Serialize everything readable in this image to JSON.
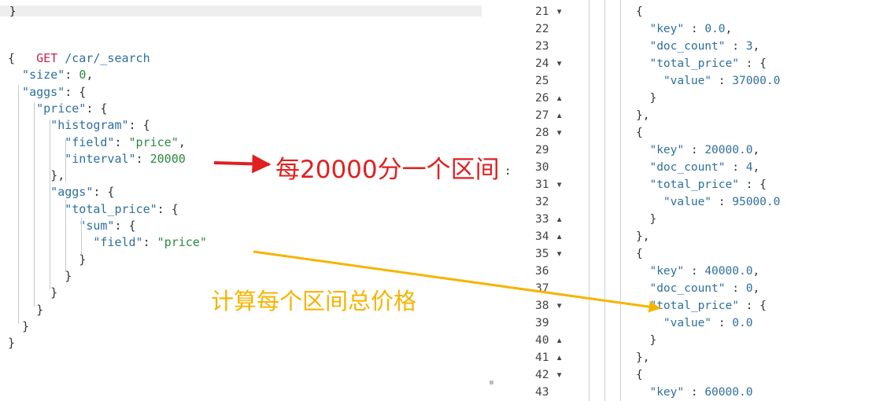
{
  "left": {
    "top_fragment": "}",
    "request_line": {
      "method": "GET",
      "path": "/car/_search"
    },
    "lines": [
      [
        "p",
        "{"
      ],
      [
        "k",
        "  \"size\"",
        "p",
        ": ",
        "n",
        "0",
        "p",
        ","
      ],
      [
        "k",
        "  \"aggs\"",
        "p",
        ": {"
      ],
      [
        "k",
        "    \"price\"",
        "p",
        ": {"
      ],
      [
        "k",
        "      \"histogram\"",
        "p",
        ": {"
      ],
      [
        "k",
        "        \"field\"",
        "p",
        ": ",
        "s",
        "\"price\"",
        "p",
        ","
      ],
      [
        "k",
        "        \"interval\"",
        "p",
        ": ",
        "n",
        "20000"
      ],
      [
        "p",
        "      },"
      ],
      [
        "k",
        "      \"aggs\"",
        "p",
        ": {"
      ],
      [
        "k",
        "        \"total_price\"",
        "p",
        ": {"
      ],
      [
        "k",
        "          \"sum\"",
        "p",
        ": {"
      ],
      [
        "k",
        "            \"field\"",
        "p",
        ": ",
        "s",
        "\"price\""
      ],
      [
        "p",
        "          }"
      ],
      [
        "p",
        "        }"
      ],
      [
        "p",
        "      }"
      ],
      [
        "p",
        "    }"
      ],
      [
        "p",
        "  }"
      ],
      [
        "p",
        "}"
      ]
    ]
  },
  "right": {
    "rows": [
      {
        "num": "21",
        "fold": "▾",
        "text": [
          [
            "p",
            "{"
          ]
        ]
      },
      {
        "num": "22",
        "fold": "",
        "text": [
          [
            "k",
            "  \"key\""
          ],
          [
            "p",
            " : "
          ],
          [
            "n",
            "0.0"
          ],
          [
            "p",
            ","
          ]
        ]
      },
      {
        "num": "23",
        "fold": "",
        "text": [
          [
            "k",
            "  \"doc_count\""
          ],
          [
            "p",
            " : "
          ],
          [
            "n",
            "3"
          ],
          [
            "p",
            ","
          ]
        ]
      },
      {
        "num": "24",
        "fold": "▾",
        "text": [
          [
            "k",
            "  \"total_price\""
          ],
          [
            "p",
            " : {"
          ]
        ]
      },
      {
        "num": "25",
        "fold": "",
        "text": [
          [
            "k",
            "    \"value\""
          ],
          [
            "p",
            " : "
          ],
          [
            "n",
            "37000.0"
          ]
        ]
      },
      {
        "num": "26",
        "fold": "▴",
        "text": [
          [
            "p",
            "  }"
          ]
        ]
      },
      {
        "num": "27",
        "fold": "▴",
        "text": [
          [
            "p",
            "},"
          ]
        ]
      },
      {
        "num": "28",
        "fold": "▾",
        "text": [
          [
            "p",
            "{"
          ]
        ]
      },
      {
        "num": "29",
        "fold": "",
        "text": [
          [
            "k",
            "  \"key\""
          ],
          [
            "p",
            " : "
          ],
          [
            "n",
            "20000.0"
          ],
          [
            "p",
            ","
          ]
        ]
      },
      {
        "num": "30",
        "fold": "",
        "text": [
          [
            "k",
            "  \"doc_count\""
          ],
          [
            "p",
            " : "
          ],
          [
            "n",
            "4"
          ],
          [
            "p",
            ","
          ]
        ]
      },
      {
        "num": "31",
        "fold": "▾",
        "text": [
          [
            "k",
            "  \"total_price\""
          ],
          [
            "p",
            " : {"
          ]
        ]
      },
      {
        "num": "32",
        "fold": "",
        "text": [
          [
            "k",
            "    \"value\""
          ],
          [
            "p",
            " : "
          ],
          [
            "n",
            "95000.0"
          ]
        ]
      },
      {
        "num": "33",
        "fold": "▴",
        "text": [
          [
            "p",
            "  }"
          ]
        ]
      },
      {
        "num": "34",
        "fold": "▴",
        "text": [
          [
            "p",
            "},"
          ]
        ]
      },
      {
        "num": "35",
        "fold": "▾",
        "text": [
          [
            "p",
            "{"
          ]
        ]
      },
      {
        "num": "36",
        "fold": "",
        "text": [
          [
            "k",
            "  \"key\""
          ],
          [
            "p",
            " : "
          ],
          [
            "n",
            "40000.0"
          ],
          [
            "p",
            ","
          ]
        ]
      },
      {
        "num": "37",
        "fold": "",
        "text": [
          [
            "k",
            "  \"doc_count\""
          ],
          [
            "p",
            " : "
          ],
          [
            "n",
            "0"
          ],
          [
            "p",
            ","
          ]
        ]
      },
      {
        "num": "38",
        "fold": "▾",
        "text": [
          [
            "k",
            "  \"total_price\""
          ],
          [
            "p",
            " : {"
          ]
        ]
      },
      {
        "num": "39",
        "fold": "",
        "text": [
          [
            "k",
            "    \"value\""
          ],
          [
            "p",
            " : "
          ],
          [
            "n",
            "0.0"
          ]
        ]
      },
      {
        "num": "40",
        "fold": "▴",
        "text": [
          [
            "p",
            "  }"
          ]
        ]
      },
      {
        "num": "41",
        "fold": "▴",
        "text": [
          [
            "p",
            "},"
          ]
        ]
      },
      {
        "num": "42",
        "fold": "▾",
        "text": [
          [
            "p",
            "{"
          ]
        ]
      },
      {
        "num": "43",
        "fold": "",
        "text": [
          [
            "k",
            "  \"key\""
          ],
          [
            "p",
            " : "
          ],
          [
            "n",
            "60000.0"
          ]
        ]
      }
    ]
  },
  "annotations": {
    "interval_note": "每20000分一个区间",
    "sum_note": "计算每个区间总价格"
  },
  "stray_mark": ":",
  "colors": {
    "red_arrow": "#e02020",
    "yellow_arrow": "#f6b400",
    "method": "#c7254e",
    "key": "#2f6f9f",
    "string": "#2b8a3e"
  }
}
